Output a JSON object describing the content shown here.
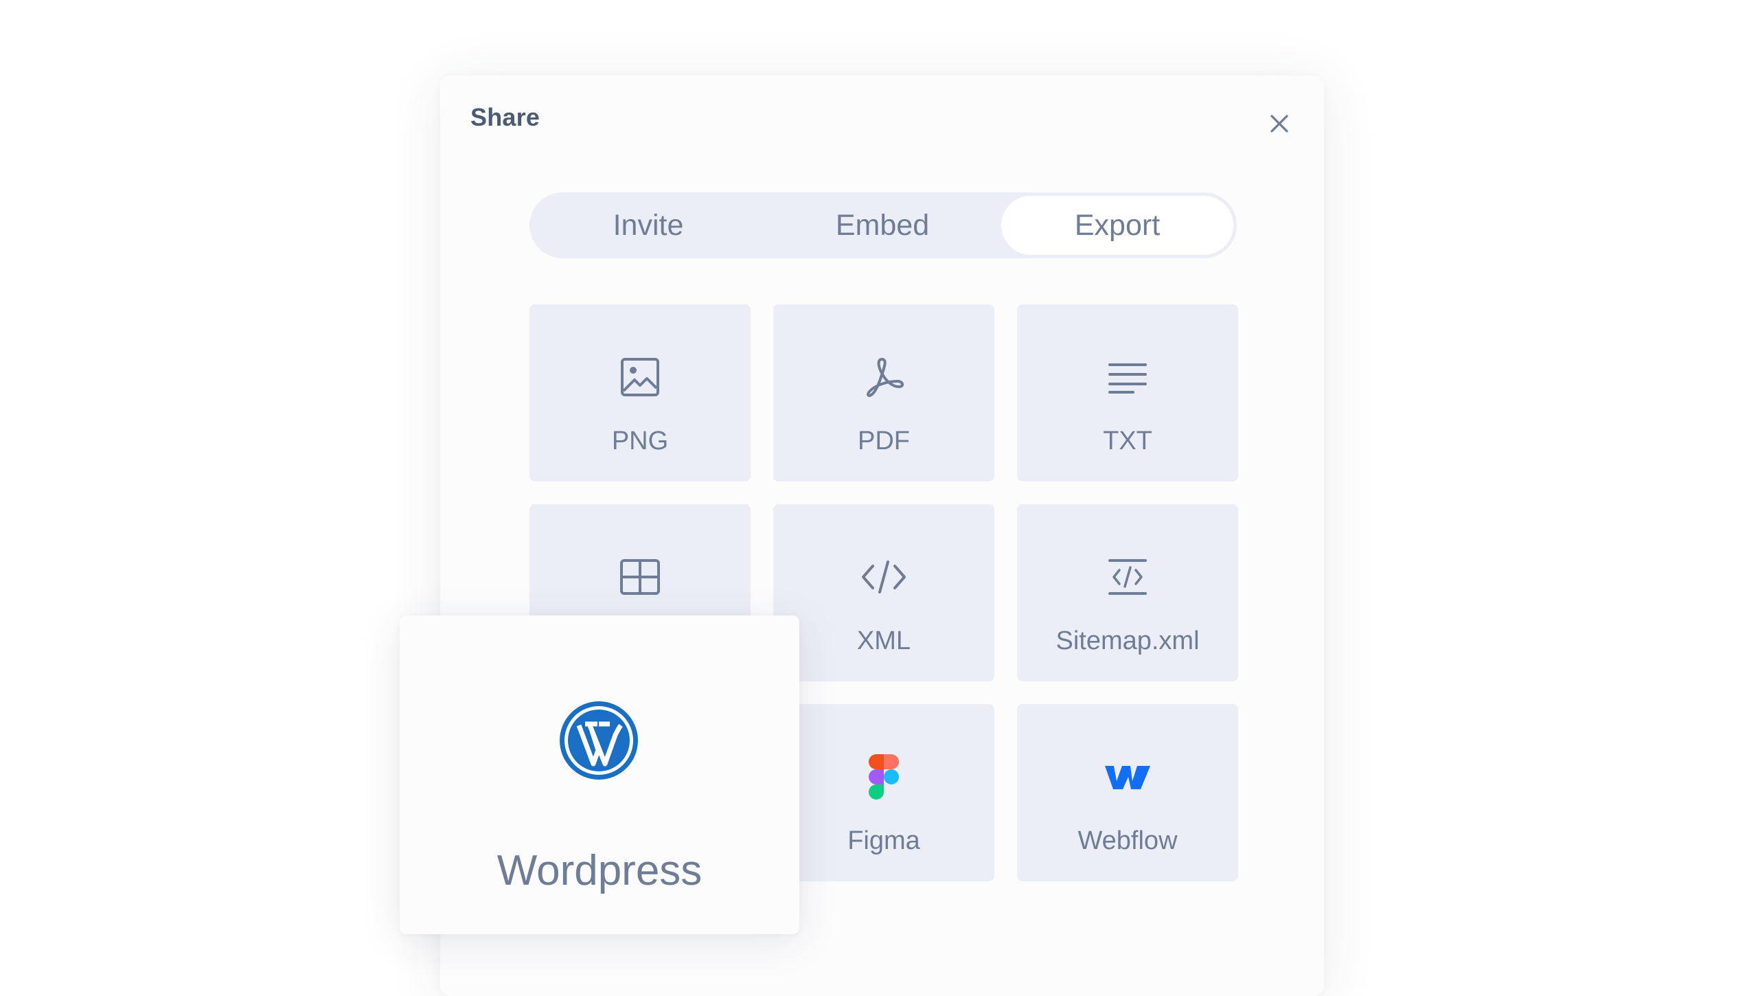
{
  "dialog": {
    "title": "Share",
    "close_icon": "close-icon"
  },
  "tabs": [
    {
      "label": "Invite",
      "active": false
    },
    {
      "label": "Embed",
      "active": false
    },
    {
      "label": "Export",
      "active": true
    }
  ],
  "export_options": [
    {
      "label": "PNG",
      "icon": "image-icon"
    },
    {
      "label": "PDF",
      "icon": "pdf-icon"
    },
    {
      "label": "TXT",
      "icon": "text-lines-icon"
    },
    {
      "label": "",
      "icon": "table-grid-icon"
    },
    {
      "label": "XML",
      "icon": "code-icon"
    },
    {
      "label": "Sitemap.xml",
      "icon": "sitemap-code-icon"
    },
    {
      "label": "Figma",
      "icon": "figma-logo-icon"
    },
    {
      "label": "Webflow",
      "icon": "webflow-logo-icon"
    }
  ],
  "highlighted_option": {
    "label": "Wordpress",
    "icon": "wordpress-logo-icon"
  },
  "colors": {
    "text": "#6f7c96",
    "title": "#4c5a73",
    "tile_bg": "#ebeef6",
    "wordpress_blue": "#1a6fc4",
    "webflow_blue": "#146ef5"
  }
}
